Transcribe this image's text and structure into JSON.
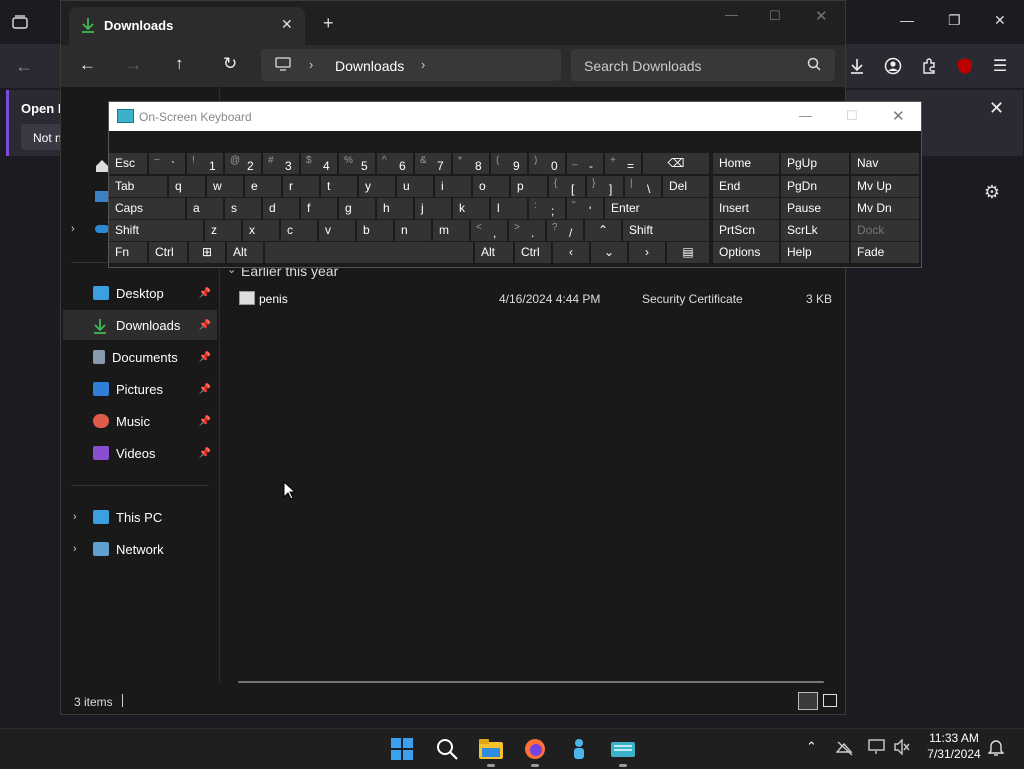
{
  "browser": {
    "notice_title": "Open F",
    "notice_button": "Not n"
  },
  "explorer": {
    "tab_title": "Downloads",
    "breadcrumb": "Downloads",
    "search_placeholder": "Search Downloads",
    "group_header": "Earlier this year",
    "files": [
      {
        "name": "penis",
        "date": "4/16/2024 4:44 PM",
        "type": "Security Certificate",
        "size": "3 KB"
      }
    ],
    "nav_items": [
      {
        "label": "Desktop"
      },
      {
        "label": "Downloads"
      },
      {
        "label": "Documents"
      },
      {
        "label": "Pictures"
      },
      {
        "label": "Music"
      },
      {
        "label": "Videos"
      },
      {
        "label": "This PC"
      },
      {
        "label": "Network"
      }
    ],
    "status_items": "3 items"
  },
  "osk": {
    "title": "On-Screen Keyboard",
    "row1": [
      {
        "shift": "~",
        "main": "`"
      },
      {
        "shift": "!",
        "main": "1"
      },
      {
        "shift": "@",
        "main": "2"
      },
      {
        "shift": "#",
        "main": "3"
      },
      {
        "shift": "$",
        "main": "4"
      },
      {
        "shift": "%",
        "main": "5"
      },
      {
        "shift": "^",
        "main": "6"
      },
      {
        "shift": "&",
        "main": "7"
      },
      {
        "shift": "*",
        "main": "8"
      },
      {
        "shift": "(",
        "main": "9"
      },
      {
        "shift": ")",
        "main": "0"
      },
      {
        "shift": "_",
        "main": "-"
      },
      {
        "shift": "+",
        "main": "="
      }
    ],
    "row2": [
      "q",
      "w",
      "e",
      "r",
      "t",
      "y",
      "u",
      "i",
      "o",
      "p"
    ],
    "row2_brackets": [
      {
        "shift": "{",
        "main": "["
      },
      {
        "shift": "}",
        "main": "]"
      },
      {
        "shift": "|",
        "main": "\\"
      }
    ],
    "row3": [
      "a",
      "s",
      "d",
      "f",
      "g",
      "h",
      "j",
      "k",
      "l"
    ],
    "row3_punct": [
      {
        "shift": ":",
        "main": ";"
      },
      {
        "shift": "\"",
        "main": "'"
      }
    ],
    "row4": [
      "z",
      "x",
      "c",
      "v",
      "b",
      "n",
      "m"
    ],
    "row4_punct": [
      {
        "shift": "<",
        "main": ","
      },
      {
        "shift": ">",
        "main": "."
      },
      {
        "shift": "?",
        "main": "/"
      }
    ],
    "labels": {
      "esc": "Esc",
      "tab": "Tab",
      "caps": "Caps",
      "shift": "Shift",
      "fn": "Fn",
      "ctrl": "Ctrl",
      "alt": "Alt",
      "del": "Del",
      "enter": "Enter",
      "shift_r": "Shift",
      "alt_r": "Alt",
      "ctrl_r": "Ctrl"
    },
    "nav_keys": [
      [
        "Home",
        "PgUp",
        "Nav"
      ],
      [
        "End",
        "PgDn",
        "Mv Up"
      ],
      [
        "Insert",
        "Pause",
        "Mv Dn"
      ],
      [
        "PrtScn",
        "ScrLk",
        "Dock"
      ],
      [
        "Options",
        "Help",
        "Fade"
      ]
    ]
  },
  "taskbar": {
    "time": "11:33 AM",
    "date": "7/31/2024"
  }
}
